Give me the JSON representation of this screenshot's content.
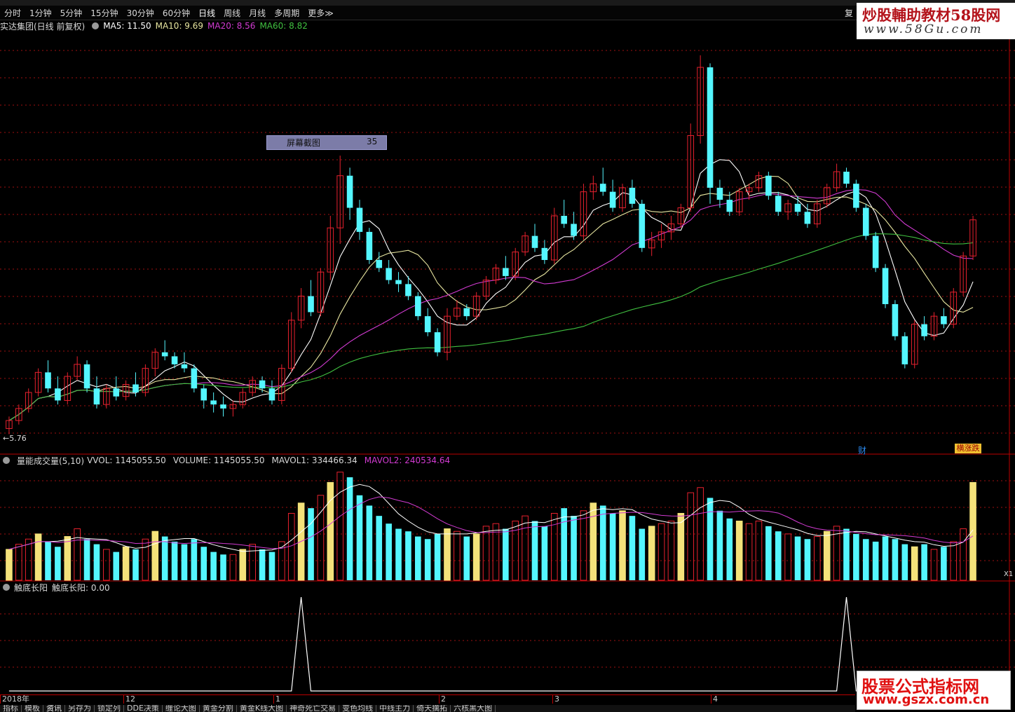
{
  "period_bar": {
    "items": [
      "分时",
      "1分钟",
      "5分钟",
      "15分钟",
      "30分钟",
      "60分钟",
      "日线",
      "周线",
      "月线",
      "多周期",
      "更多≫"
    ],
    "active": "日线",
    "right_label": "复"
  },
  "info_bar": {
    "title": "实达集团(日线 前复权)",
    "ma5": "MA5: 11.50",
    "ma10": "MA10: 9.69",
    "ma20": "MA20: 8.56",
    "ma60": "MA60: 8.82"
  },
  "watermark_top": {
    "line1": "炒股輔助教材58股网",
    "line2": "www.58Gu.com"
  },
  "watermark_bottom": {
    "line1": "股票公式指标网",
    "line2": "www.gszx.com.cn"
  },
  "tooltip": {
    "label": "屏幕截图",
    "value": "35"
  },
  "low_price_label": "5.76",
  "badges": {
    "cai": "财",
    "zhangdie": "横涨跌"
  },
  "volume_panel": {
    "title": "量能成交量(5,10)",
    "vvol": "VVOL: 1145055.50",
    "volume": "VOLUME: 1145055.50",
    "mavol1": "MAVOL1: 334466.34",
    "mavol2": "MAVOL2: 240534.64"
  },
  "indicator_panel": {
    "title": "触底长阳",
    "value": "触底长阳: 0.00"
  },
  "right_mini": "X1",
  "date_axis": [
    "2018年",
    "12",
    "1",
    "2",
    "3",
    "4"
  ],
  "bottom_tabs": [
    "指标",
    "模板",
    "资讯",
    "另存为",
    "锁定列",
    "DDE决策",
    "缠论大图",
    "黄金分割",
    "黄金K线大图",
    "神奇死亡交易",
    "变色均线",
    "中线主力",
    "倚天擒拓",
    "六核黑大图"
  ],
  "colors": {
    "up": "#e8212e",
    "down": "#54f6ff",
    "ma5": "#ffffff",
    "ma10": "#e8e6a0",
    "ma20": "#d23bd2",
    "ma60": "#40c040",
    "grid": "#a01010"
  },
  "chart_data": {
    "type": "candlestick",
    "series_ma": [
      "MA5",
      "MA10",
      "MA20",
      "MA60"
    ],
    "candles_ohlc": [
      [
        5.9,
        6.2,
        5.76,
        6.1
      ],
      [
        6.1,
        6.5,
        6.0,
        6.4
      ],
      [
        6.4,
        6.9,
        6.3,
        6.8
      ],
      [
        6.8,
        7.4,
        6.7,
        7.3
      ],
      [
        7.3,
        7.6,
        6.8,
        6.9
      ],
      [
        6.9,
        7.2,
        6.5,
        6.6
      ],
      [
        6.6,
        7.3,
        6.5,
        7.2
      ],
      [
        7.2,
        7.7,
        7.1,
        7.5
      ],
      [
        7.5,
        7.6,
        6.8,
        6.9
      ],
      [
        6.9,
        7.2,
        6.4,
        6.5
      ],
      [
        6.5,
        7.0,
        6.4,
        6.9
      ],
      [
        6.9,
        7.2,
        6.6,
        6.7
      ],
      [
        6.7,
        7.1,
        6.6,
        7.0
      ],
      [
        7.0,
        7.3,
        6.7,
        6.8
      ],
      [
        6.8,
        7.5,
        6.7,
        7.4
      ],
      [
        7.4,
        7.9,
        7.2,
        7.8
      ],
      [
        7.8,
        8.1,
        7.6,
        7.7
      ],
      [
        7.7,
        7.8,
        7.4,
        7.5
      ],
      [
        7.5,
        7.8,
        7.3,
        7.4
      ],
      [
        7.4,
        7.5,
        6.8,
        6.9
      ],
      [
        6.9,
        7.0,
        6.4,
        6.6
      ],
      [
        6.6,
        6.8,
        6.3,
        6.5
      ],
      [
        6.5,
        6.7,
        6.2,
        6.4
      ],
      [
        6.4,
        6.6,
        6.2,
        6.5
      ],
      [
        6.5,
        6.9,
        6.4,
        6.8
      ],
      [
        6.8,
        7.2,
        6.7,
        7.1
      ],
      [
        7.1,
        7.2,
        6.8,
        6.9
      ],
      [
        6.9,
        7.1,
        6.5,
        6.6
      ],
      [
        6.6,
        7.5,
        6.5,
        7.4
      ],
      [
        7.4,
        8.8,
        7.3,
        8.6
      ],
      [
        8.6,
        9.4,
        8.4,
        9.2
      ],
      [
        9.2,
        9.6,
        8.7,
        8.8
      ],
      [
        8.8,
        9.9,
        8.7,
        9.8
      ],
      [
        9.8,
        11.2,
        9.6,
        10.9
      ],
      [
        10.9,
        12.7,
        10.5,
        12.2
      ],
      [
        12.2,
        12.4,
        11.1,
        11.4
      ],
      [
        11.4,
        11.6,
        10.6,
        10.8
      ],
      [
        10.8,
        10.9,
        10.0,
        10.1
      ],
      [
        10.1,
        10.3,
        9.8,
        9.9
      ],
      [
        9.9,
        10.1,
        9.5,
        9.6
      ],
      [
        9.6,
        9.8,
        9.3,
        9.5
      ],
      [
        9.5,
        9.7,
        9.1,
        9.2
      ],
      [
        9.2,
        9.3,
        8.6,
        8.7
      ],
      [
        8.7,
        8.9,
        8.2,
        8.3
      ],
      [
        8.3,
        8.4,
        7.7,
        7.8
      ],
      [
        7.8,
        8.9,
        7.6,
        8.7
      ],
      [
        8.7,
        9.1,
        8.6,
        8.9
      ],
      [
        8.9,
        9.0,
        8.6,
        8.7
      ],
      [
        8.7,
        9.3,
        8.6,
        9.2
      ],
      [
        9.2,
        9.7,
        9.1,
        9.6
      ],
      [
        9.6,
        10.0,
        9.5,
        9.9
      ],
      [
        9.9,
        10.2,
        9.6,
        9.7
      ],
      [
        9.7,
        10.4,
        9.6,
        10.3
      ],
      [
        10.3,
        10.8,
        10.2,
        10.7
      ],
      [
        10.7,
        11.0,
        10.3,
        10.4
      ],
      [
        10.4,
        10.6,
        10.0,
        10.1
      ],
      [
        10.1,
        11.4,
        10.0,
        11.2
      ],
      [
        11.2,
        11.6,
        10.9,
        11.0
      ],
      [
        11.0,
        11.3,
        10.6,
        10.7
      ],
      [
        10.7,
        12.0,
        10.6,
        11.8
      ],
      [
        11.8,
        12.2,
        11.6,
        12.0
      ],
      [
        12.0,
        12.4,
        11.7,
        11.8
      ],
      [
        11.8,
        12.1,
        11.3,
        11.4
      ],
      [
        11.4,
        12.0,
        11.3,
        11.9
      ],
      [
        11.9,
        12.1,
        11.4,
        11.5
      ],
      [
        11.5,
        11.6,
        10.3,
        10.4
      ],
      [
        10.4,
        10.8,
        10.2,
        10.6
      ],
      [
        10.6,
        11.0,
        10.4,
        10.8
      ],
      [
        10.8,
        11.2,
        10.6,
        11.0
      ],
      [
        11.0,
        11.5,
        10.9,
        11.4
      ],
      [
        11.4,
        13.5,
        11.3,
        13.2
      ],
      [
        13.2,
        15.2,
        13.0,
        14.9
      ],
      [
        14.9,
        15.0,
        11.5,
        11.9
      ],
      [
        11.9,
        12.1,
        11.4,
        11.6
      ],
      [
        11.6,
        11.8,
        11.2,
        11.3
      ],
      [
        11.3,
        11.9,
        11.2,
        11.8
      ],
      [
        11.8,
        12.0,
        11.6,
        11.9
      ],
      [
        11.9,
        12.3,
        11.8,
        12.2
      ],
      [
        12.2,
        12.3,
        11.6,
        11.7
      ],
      [
        11.7,
        11.8,
        11.2,
        11.3
      ],
      [
        11.3,
        11.6,
        11.1,
        11.5
      ],
      [
        11.5,
        11.7,
        11.2,
        11.3
      ],
      [
        11.3,
        11.5,
        10.9,
        11.0
      ],
      [
        11.0,
        11.6,
        10.9,
        11.5
      ],
      [
        11.5,
        12.0,
        11.4,
        11.9
      ],
      [
        11.9,
        12.5,
        11.8,
        12.3
      ],
      [
        12.3,
        12.4,
        11.9,
        12.0
      ],
      [
        12.0,
        12.1,
        11.3,
        11.4
      ],
      [
        11.4,
        11.5,
        10.6,
        10.7
      ],
      [
        10.7,
        10.8,
        9.8,
        9.9
      ],
      [
        9.9,
        10.0,
        8.9,
        9.0
      ],
      [
        9.0,
        9.1,
        8.1,
        8.2
      ],
      [
        8.2,
        8.3,
        7.4,
        7.5
      ],
      [
        7.5,
        8.6,
        7.4,
        8.5
      ],
      [
        8.5,
        8.7,
        8.1,
        8.2
      ],
      [
        8.2,
        8.8,
        8.1,
        8.7
      ],
      [
        8.7,
        8.9,
        8.4,
        8.5
      ],
      [
        8.5,
        9.4,
        8.4,
        9.3
      ],
      [
        9.3,
        10.3,
        9.2,
        10.2
      ],
      [
        10.2,
        11.2,
        10.1,
        11.1
      ]
    ],
    "volume": [
      120,
      140,
      160,
      180,
      150,
      130,
      170,
      200,
      160,
      140,
      120,
      110,
      130,
      120,
      160,
      190,
      170,
      150,
      140,
      160,
      130,
      110,
      100,
      100,
      120,
      140,
      120,
      110,
      150,
      260,
      300,
      280,
      330,
      380,
      420,
      400,
      330,
      290,
      250,
      220,
      200,
      190,
      170,
      160,
      180,
      200,
      190,
      170,
      180,
      210,
      220,
      200,
      230,
      250,
      230,
      210,
      260,
      280,
      250,
      270,
      300,
      290,
      260,
      270,
      250,
      200,
      210,
      220,
      230,
      260,
      340,
      360,
      320,
      270,
      240,
      230,
      220,
      230,
      210,
      190,
      180,
      170,
      160,
      170,
      190,
      210,
      200,
      180,
      160,
      150,
      170,
      160,
      140,
      130,
      140,
      120,
      130,
      150,
      200,
      380
    ],
    "indicator_spikes_at": [
      30,
      86
    ]
  }
}
